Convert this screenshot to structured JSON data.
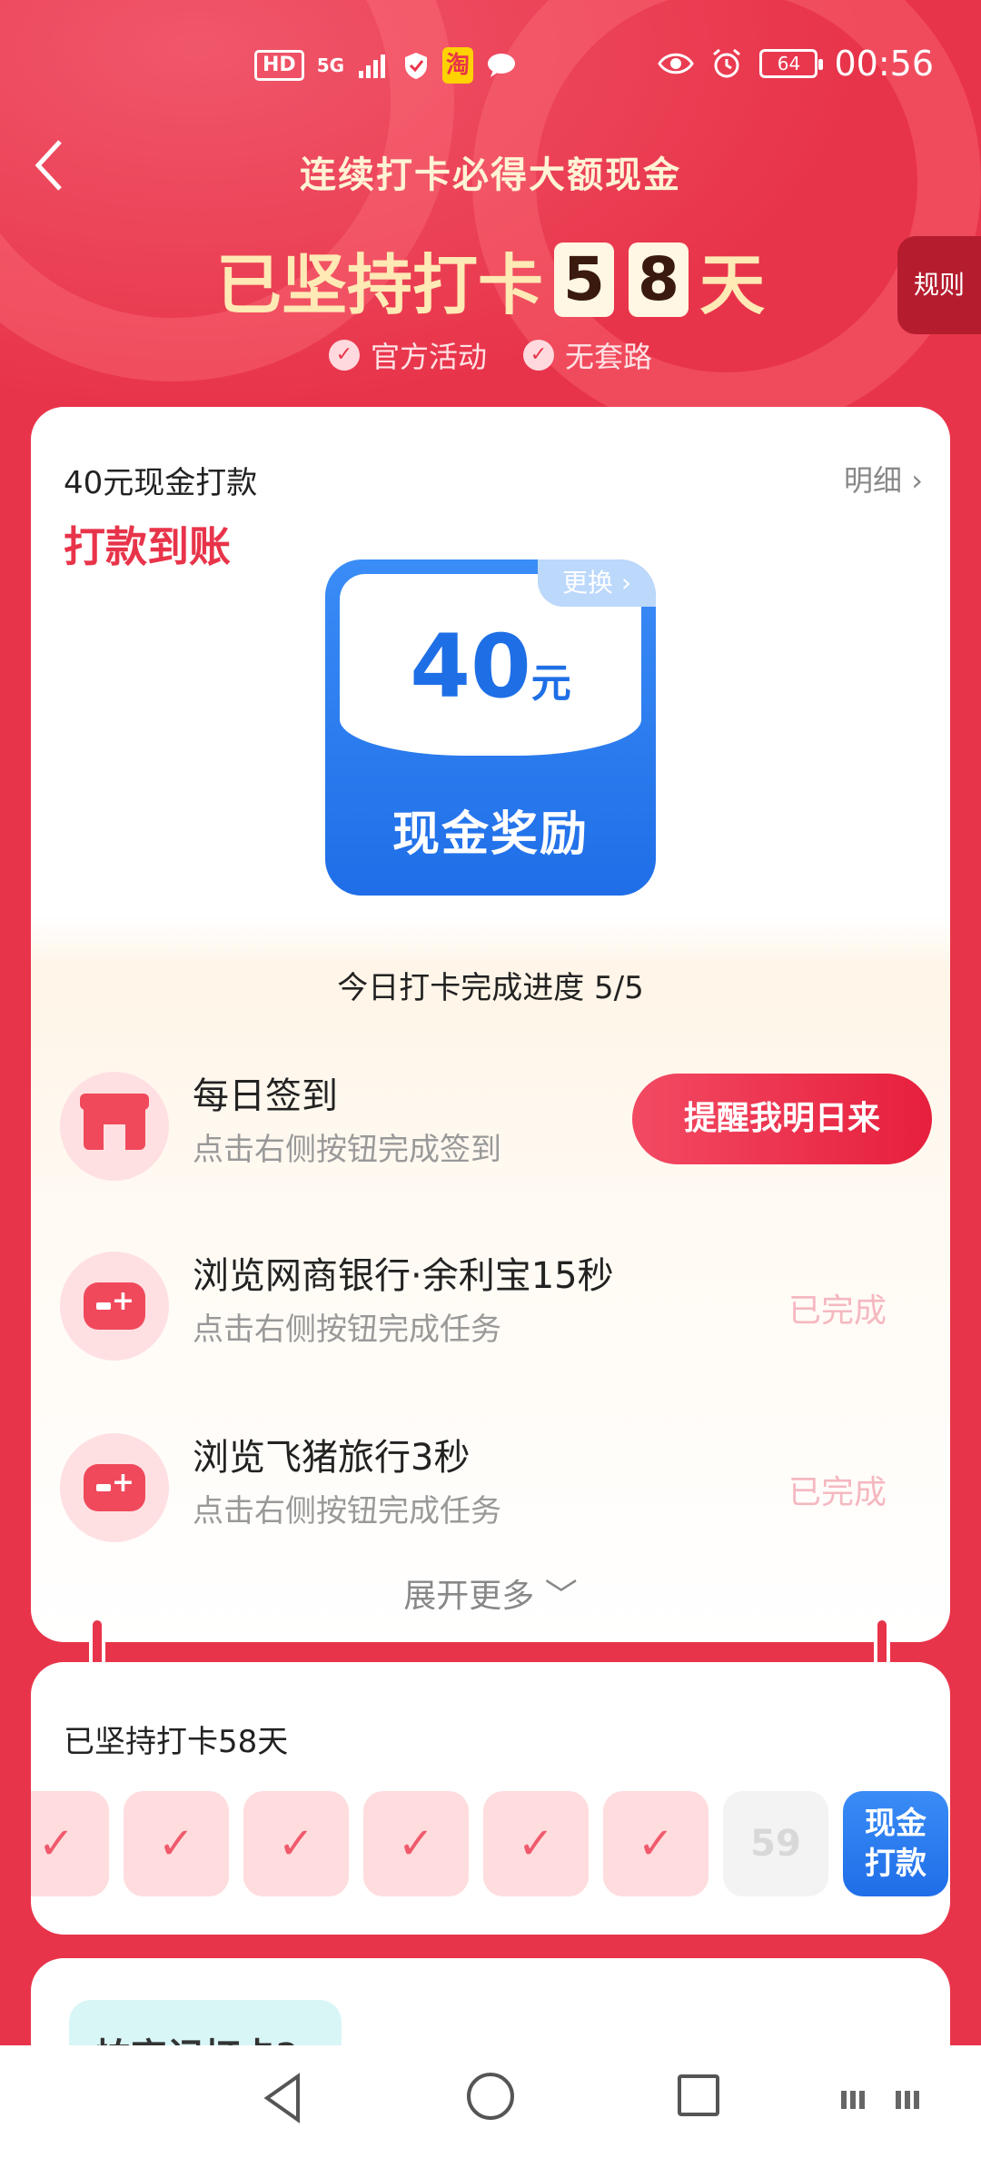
{
  "status_bar": {
    "left_items": [
      "HD",
      "5G",
      "signal",
      "shield",
      "淘",
      "chat"
    ],
    "battery": "64",
    "time": "00:56"
  },
  "header": {
    "back_label": "‹",
    "subtitle": "连续打卡必得大额现金",
    "streak_prefix": "已坚持打卡",
    "streak_digit_1": "5",
    "streak_digit_2": "8",
    "streak_suffix": "天",
    "rules": "规则",
    "badges": [
      "官方活动",
      "无套路"
    ]
  },
  "reward_card": {
    "title": "40元现金打款",
    "detail": "明细",
    "status": "打款到账",
    "amount": "40",
    "unit": "元",
    "change_label": "更换",
    "reward_label": "现金奖励",
    "progress": "今日打卡完成进度 5/5",
    "tasks": [
      {
        "name": "每日签到",
        "desc": "点击右侧按钮完成签到",
        "action": "提醒我明日来",
        "icon": "store-icon"
      },
      {
        "name": "浏览网商银行·余利宝15秒",
        "desc": "点击右侧按钮完成任务",
        "status": "已完成",
        "icon": "gamepad-icon"
      },
      {
        "name": "浏览飞猪旅行3秒",
        "desc": "点击右侧按钮完成任务",
        "status": "已完成",
        "icon": "gamepad-icon"
      }
    ],
    "expand": "展开更多"
  },
  "streak_card": {
    "title": "已坚持打卡58天",
    "next_day": "59",
    "cash_label_1": "现金",
    "cash_label_2": "打款"
  },
  "bottom_card": {
    "tag": "怕忘记打卡?"
  },
  "colors": {
    "brand_red": "#e8344a",
    "reward_blue": "#1f6ee8",
    "done_pink": "#f5b8c0"
  }
}
